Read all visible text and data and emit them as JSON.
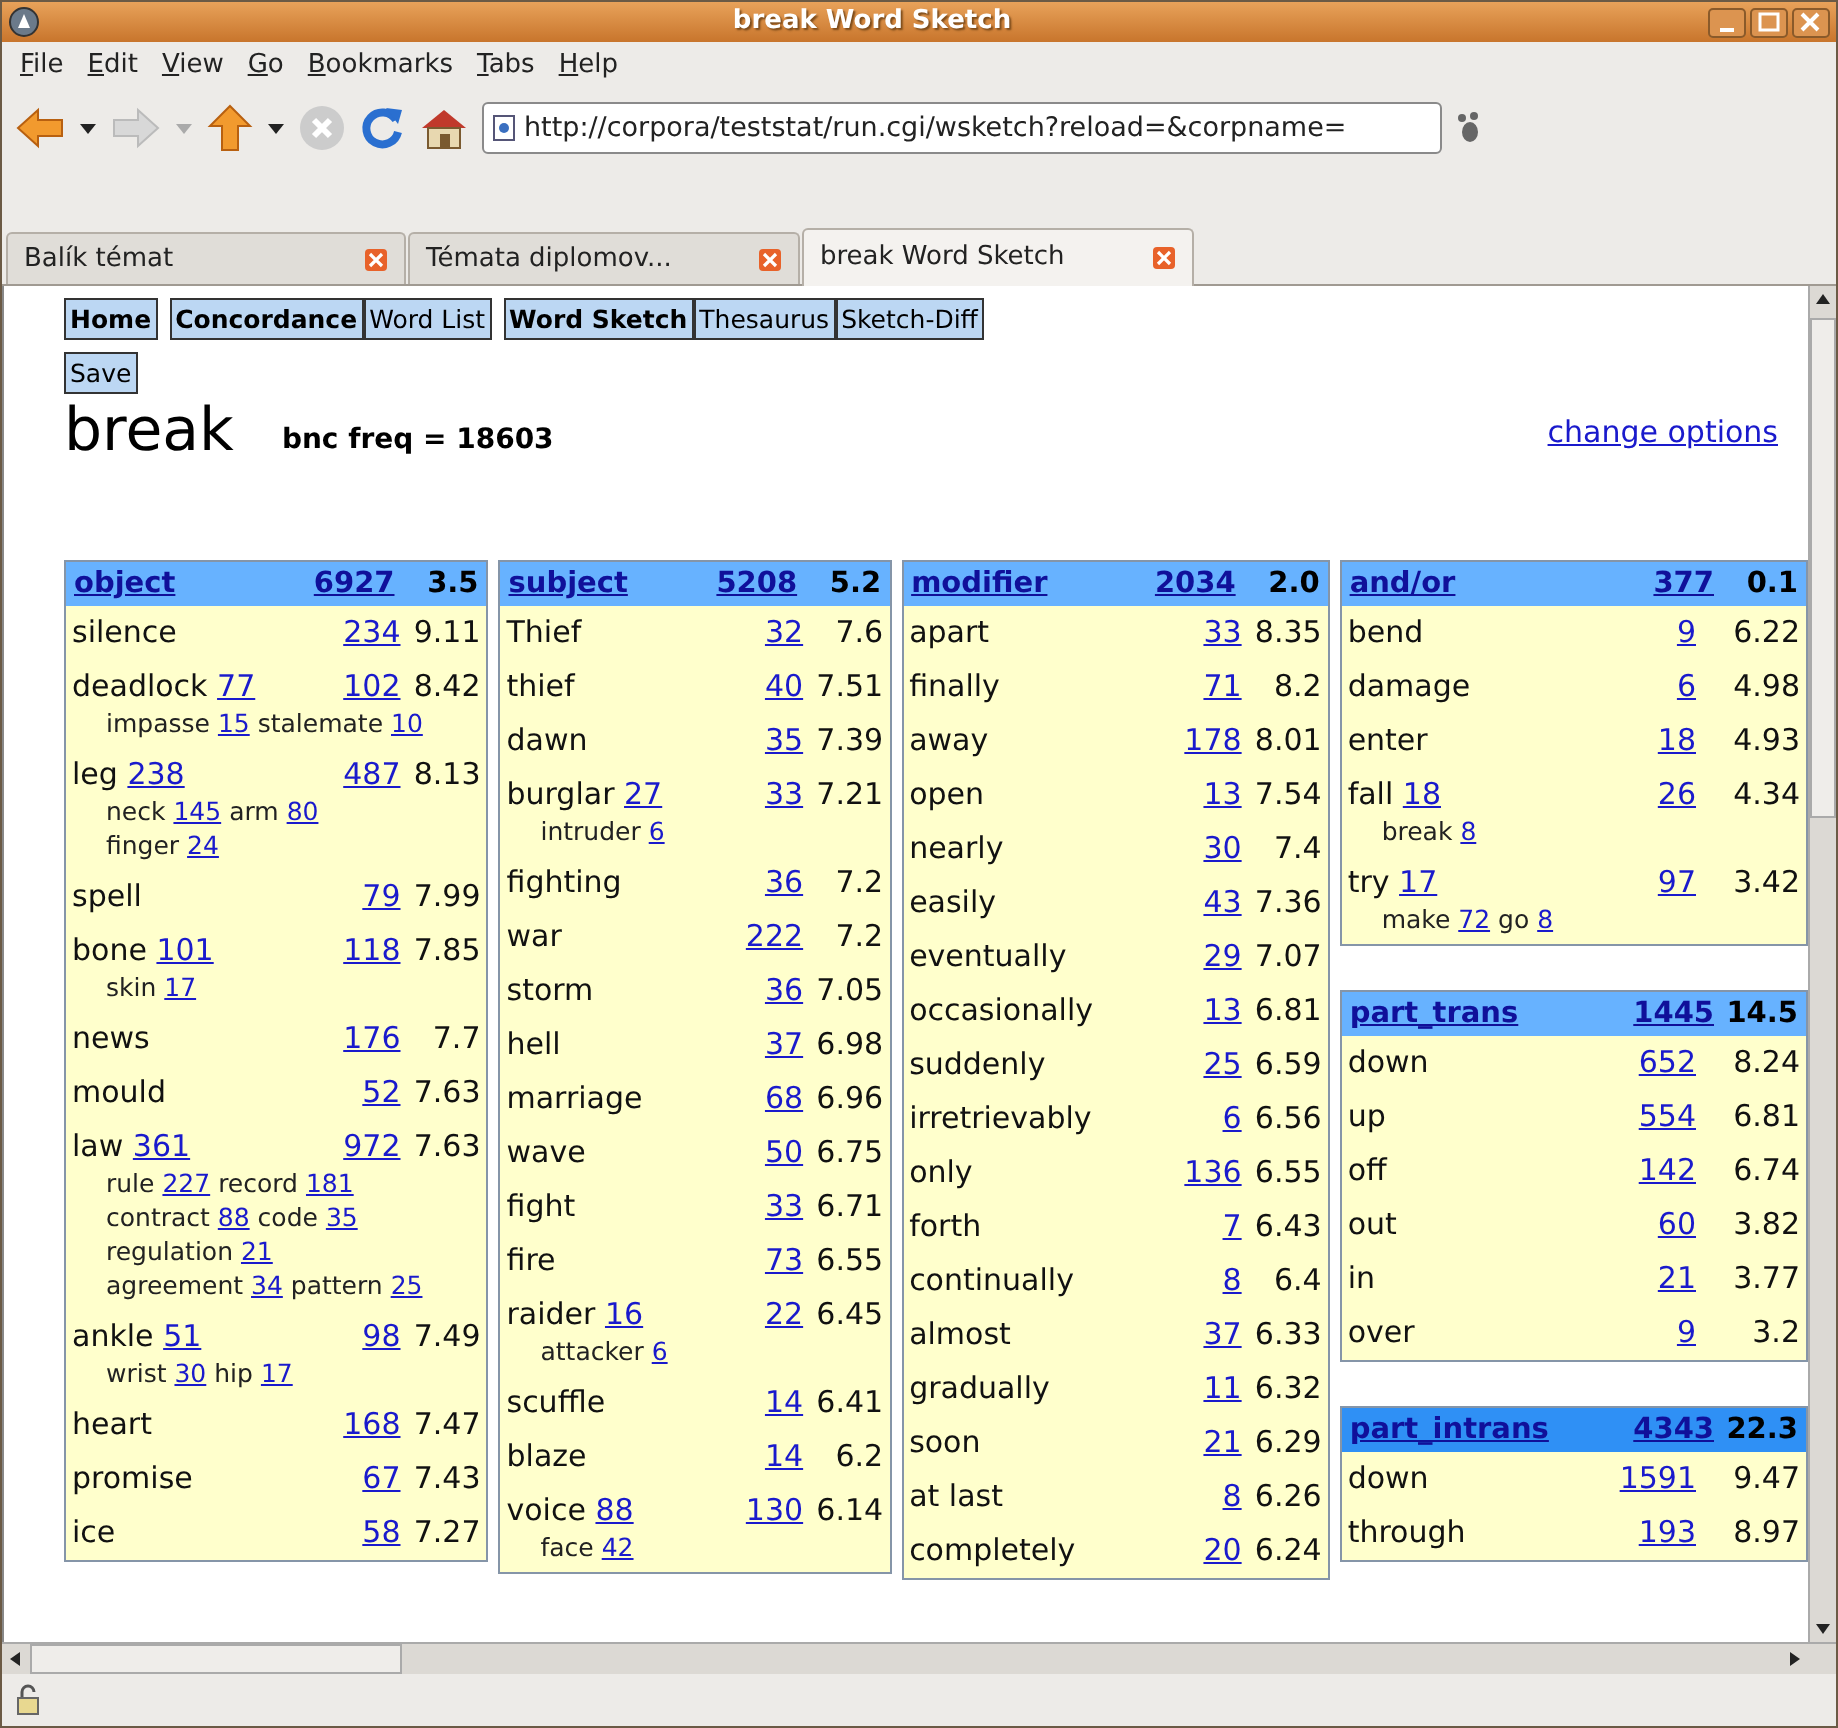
{
  "window": {
    "title": "break Word Sketch"
  },
  "menu": [
    "File",
    "Edit",
    "View",
    "Go",
    "Bookmarks",
    "Tabs",
    "Help"
  ],
  "address_bar": {
    "value": "http://corpora/teststat/run.cgi/wsketch?reload=&corpname="
  },
  "tabs": [
    {
      "label": "Balík témat",
      "selected": false
    },
    {
      "label": "Témata diplomov...",
      "selected": false
    },
    {
      "label": "break Word Sketch",
      "selected": true
    }
  ],
  "nav_groups": [
    [
      {
        "label": "Home",
        "bold": true
      }
    ],
    [
      {
        "label": "Concordance",
        "bold": true
      },
      {
        "label": "Word List",
        "bold": false
      }
    ],
    [
      {
        "label": "Word Sketch",
        "bold": true
      },
      {
        "label": "Thesaurus",
        "bold": false
      },
      {
        "label": "Sketch-Diff",
        "bold": false
      }
    ]
  ],
  "save_button": "Save",
  "headword": "break",
  "frequency": "bnc freq = 18603",
  "options_link": "change options",
  "columns": [
    {
      "tables": [
        {
          "relation": "object",
          "count": "6927",
          "score": "3.5",
          "highlighted": false,
          "rows": [
            {
              "word": "silence",
              "count": "234",
              "score": "9.11"
            },
            {
              "word": "deadlock",
              "inline_count": "77",
              "count": "102",
              "score": "8.42",
              "sub_lines": [
                [
                  {
                    "word": "impasse",
                    "count": "15"
                  },
                  {
                    "word": "stalemate",
                    "count": "10"
                  }
                ]
              ]
            },
            {
              "word": "leg",
              "inline_count": "238",
              "count": "487",
              "score": "8.13",
              "sub_lines": [
                [
                  {
                    "word": "neck",
                    "count": "145"
                  },
                  {
                    "word": "arm",
                    "count": "80"
                  }
                ],
                [
                  {
                    "word": "finger",
                    "count": "24"
                  }
                ]
              ]
            },
            {
              "word": "spell",
              "count": "79",
              "score": "7.99"
            },
            {
              "word": "bone",
              "inline_count": "101",
              "count": "118",
              "score": "7.85",
              "sub_lines": [
                [
                  {
                    "word": "skin",
                    "count": "17"
                  }
                ]
              ]
            },
            {
              "word": "news",
              "count": "176",
              "score": "7.7"
            },
            {
              "word": "mould",
              "count": "52",
              "score": "7.63"
            },
            {
              "word": "law",
              "inline_count": "361",
              "count": "972",
              "score": "7.63",
              "sub_lines": [
                [
                  {
                    "word": "rule",
                    "count": "227"
                  },
                  {
                    "word": "record",
                    "count": "181"
                  }
                ],
                [
                  {
                    "word": "contract",
                    "count": "88"
                  },
                  {
                    "word": "code",
                    "count": "35"
                  }
                ],
                [
                  {
                    "word": "regulation",
                    "count": "21"
                  }
                ],
                [
                  {
                    "word": "agreement",
                    "count": "34"
                  },
                  {
                    "word": "pattern",
                    "count": "25"
                  }
                ]
              ]
            },
            {
              "word": "ankle",
              "inline_count": "51",
              "count": "98",
              "score": "7.49",
              "sub_lines": [
                [
                  {
                    "word": "wrist",
                    "count": "30"
                  },
                  {
                    "word": "hip",
                    "count": "17"
                  }
                ]
              ]
            },
            {
              "word": "heart",
              "count": "168",
              "score": "7.47"
            },
            {
              "word": "promise",
              "count": "67",
              "score": "7.43"
            },
            {
              "word": "ice",
              "count": "58",
              "score": "7.27"
            }
          ]
        }
      ]
    },
    {
      "tables": [
        {
          "relation": "subject",
          "count": "5208",
          "score": "5.2",
          "highlighted": false,
          "rows": [
            {
              "word": "Thief",
              "count": "32",
              "score": "7.6"
            },
            {
              "word": "thief",
              "count": "40",
              "score": "7.51"
            },
            {
              "word": "dawn",
              "count": "35",
              "score": "7.39"
            },
            {
              "word": "burglar",
              "inline_count": "27",
              "count": "33",
              "score": "7.21",
              "sub_lines": [
                [
                  {
                    "word": "intruder",
                    "count": "6"
                  }
                ]
              ]
            },
            {
              "word": "fighting",
              "count": "36",
              "score": "7.2"
            },
            {
              "word": "war",
              "count": "222",
              "score": "7.2"
            },
            {
              "word": "storm",
              "count": "36",
              "score": "7.05"
            },
            {
              "word": "hell",
              "count": "37",
              "score": "6.98"
            },
            {
              "word": "marriage",
              "count": "68",
              "score": "6.96"
            },
            {
              "word": "wave",
              "count": "50",
              "score": "6.75"
            },
            {
              "word": "fight",
              "count": "33",
              "score": "6.71"
            },
            {
              "word": "fire",
              "count": "73",
              "score": "6.55"
            },
            {
              "word": "raider",
              "inline_count": "16",
              "count": "22",
              "score": "6.45",
              "sub_lines": [
                [
                  {
                    "word": "attacker",
                    "count": "6"
                  }
                ]
              ]
            },
            {
              "word": "scuffle",
              "count": "14",
              "score": "6.41"
            },
            {
              "word": "blaze",
              "count": "14",
              "score": "6.2"
            },
            {
              "word": "voice",
              "inline_count": "88",
              "count": "130",
              "score": "6.14",
              "sub_lines": [
                [
                  {
                    "word": "face",
                    "count": "42"
                  }
                ]
              ]
            }
          ]
        }
      ]
    },
    {
      "tables": [
        {
          "relation": "modifier",
          "count": "2034",
          "score": "2.0",
          "highlighted": false,
          "rows": [
            {
              "word": "apart",
              "count": "33",
              "score": "8.35"
            },
            {
              "word": "finally",
              "count": "71",
              "score": "8.2"
            },
            {
              "word": "away",
              "count": "178",
              "score": "8.01"
            },
            {
              "word": "open",
              "count": "13",
              "score": "7.54"
            },
            {
              "word": "nearly",
              "count": "30",
              "score": "7.4"
            },
            {
              "word": "easily",
              "count": "43",
              "score": "7.36"
            },
            {
              "word": "eventually",
              "count": "29",
              "score": "7.07"
            },
            {
              "word": "occasionally",
              "count": "13",
              "score": "6.81"
            },
            {
              "word": "suddenly",
              "count": "25",
              "score": "6.59"
            },
            {
              "word": "irretrievably",
              "count": "6",
              "score": "6.56"
            },
            {
              "word": "only",
              "count": "136",
              "score": "6.55"
            },
            {
              "word": "forth",
              "count": "7",
              "score": "6.43"
            },
            {
              "word": "continually",
              "count": "8",
              "score": "6.4"
            },
            {
              "word": "almost",
              "count": "37",
              "score": "6.33"
            },
            {
              "word": "gradually",
              "count": "11",
              "score": "6.32"
            },
            {
              "word": "soon",
              "count": "21",
              "score": "6.29"
            },
            {
              "word": "at last",
              "count": "8",
              "score": "6.26"
            },
            {
              "word": "completely",
              "count": "20",
              "score": "6.24"
            }
          ]
        }
      ]
    },
    {
      "tables": [
        {
          "relation": "and/or",
          "count": "377",
          "score": "0.1",
          "highlighted": false,
          "rows": [
            {
              "word": "bend",
              "count": "9",
              "score": "6.22"
            },
            {
              "word": "damage",
              "count": "6",
              "score": "4.98"
            },
            {
              "word": "enter",
              "count": "18",
              "score": "4.93"
            },
            {
              "word": "fall",
              "inline_count": "18",
              "count": "26",
              "score": "4.34",
              "sub_lines": [
                [
                  {
                    "word": "break",
                    "count": "8"
                  }
                ]
              ]
            },
            {
              "word": "try",
              "inline_count": "17",
              "count": "97",
              "score": "3.42",
              "sub_lines": [
                [
                  {
                    "word": "make",
                    "count": "72"
                  },
                  {
                    "word": "go",
                    "count": "8"
                  }
                ]
              ]
            }
          ]
        },
        {
          "relation": "part_trans",
          "count": "1445",
          "score": "14.5",
          "highlighted": false,
          "rows": [
            {
              "word": "down",
              "count": "652",
              "score": "8.24"
            },
            {
              "word": "up",
              "count": "554",
              "score": "6.81"
            },
            {
              "word": "off",
              "count": "142",
              "score": "6.74"
            },
            {
              "word": "out",
              "count": "60",
              "score": "3.82"
            },
            {
              "word": "in",
              "count": "21",
              "score": "3.77"
            },
            {
              "word": "over",
              "count": "9",
              "score": "3.2"
            }
          ]
        },
        {
          "relation": "part_intrans",
          "count": "4343",
          "score": "22.3",
          "highlighted": true,
          "rows": [
            {
              "word": "down",
              "count": "1591",
              "score": "9.47"
            },
            {
              "word": "through",
              "count": "193",
              "score": "8.97"
            }
          ]
        }
      ]
    }
  ]
}
